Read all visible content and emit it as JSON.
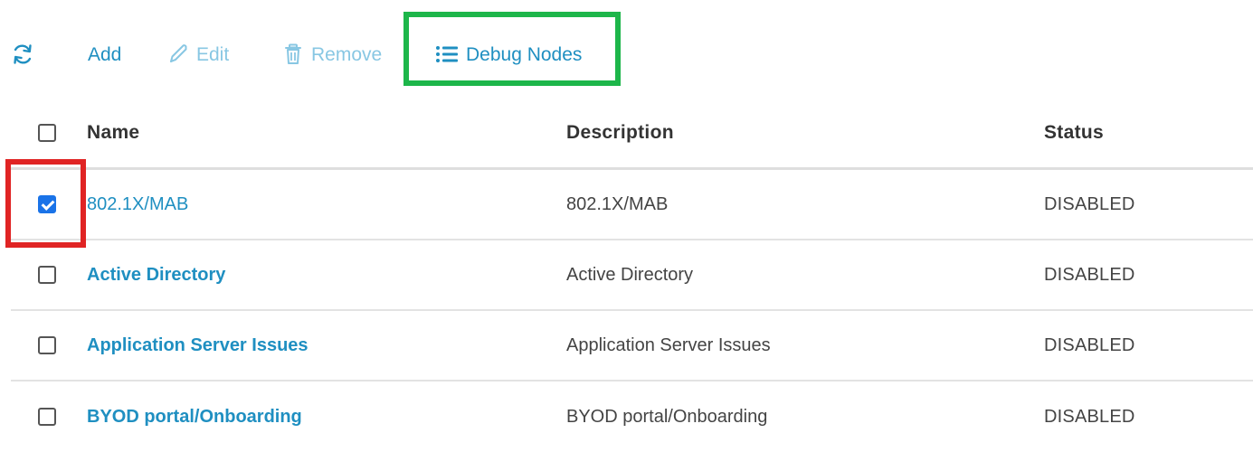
{
  "toolbar": {
    "refresh_icon": "refresh-icon",
    "add_label": "Add",
    "edit_label": "Edit",
    "remove_label": "Remove",
    "debug_label": "Debug Nodes"
  },
  "table": {
    "columns": {
      "name": "Name",
      "description": "Description",
      "status": "Status"
    },
    "rows": [
      {
        "name": "802.1X/MAB",
        "description": "802.1X/MAB",
        "status": "DISABLED",
        "checked": true
      },
      {
        "name": "Active Directory",
        "description": "Active Directory",
        "status": "DISABLED",
        "checked": false
      },
      {
        "name": "Application Server Issues",
        "description": "Application Server Issues",
        "status": "DISABLED",
        "checked": false
      },
      {
        "name": "BYOD portal/Onboarding",
        "description": "BYOD portal/Onboarding",
        "status": "DISABLED",
        "checked": false
      }
    ]
  },
  "colors": {
    "link": "#1f8fc1",
    "disabled_action": "#88c7e3",
    "highlight_green": "#1db64a",
    "highlight_red": "#e02424",
    "checkbox_checked": "#1a73e8"
  }
}
